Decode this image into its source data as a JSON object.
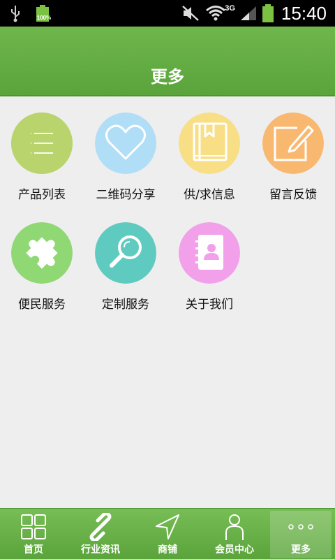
{
  "status_bar": {
    "battery_percent": "100%",
    "network": "3G",
    "time": "15:40"
  },
  "header": {
    "title": "更多"
  },
  "menu": [
    {
      "label": "产品列表",
      "icon": "list-icon",
      "color": "#b7d36a"
    },
    {
      "label": "二维码分享",
      "icon": "heart-icon",
      "color": "#aedcf5"
    },
    {
      "label": "供/求信息",
      "icon": "book-icon",
      "color": "#f7dc7e"
    },
    {
      "label": "留言反馈",
      "icon": "edit-icon",
      "color": "#f9b46a"
    },
    {
      "label": "便民服务",
      "icon": "puzzle-icon",
      "color": "#8bd870"
    },
    {
      "label": "定制服务",
      "icon": "magnifier-icon",
      "color": "#5ccabf"
    },
    {
      "label": "关于我们",
      "icon": "contacts-icon",
      "color": "#f19ce8"
    }
  ],
  "tab_bar": {
    "items": [
      {
        "label": "首页",
        "icon": "grid-icon"
      },
      {
        "label": "行业资讯",
        "icon": "link-icon"
      },
      {
        "label": "商铺",
        "icon": "navigation-arrow-icon"
      },
      {
        "label": "会员中心",
        "icon": "person-icon"
      },
      {
        "label": "更多",
        "icon": "more-dots-icon",
        "active": true
      }
    ]
  }
}
